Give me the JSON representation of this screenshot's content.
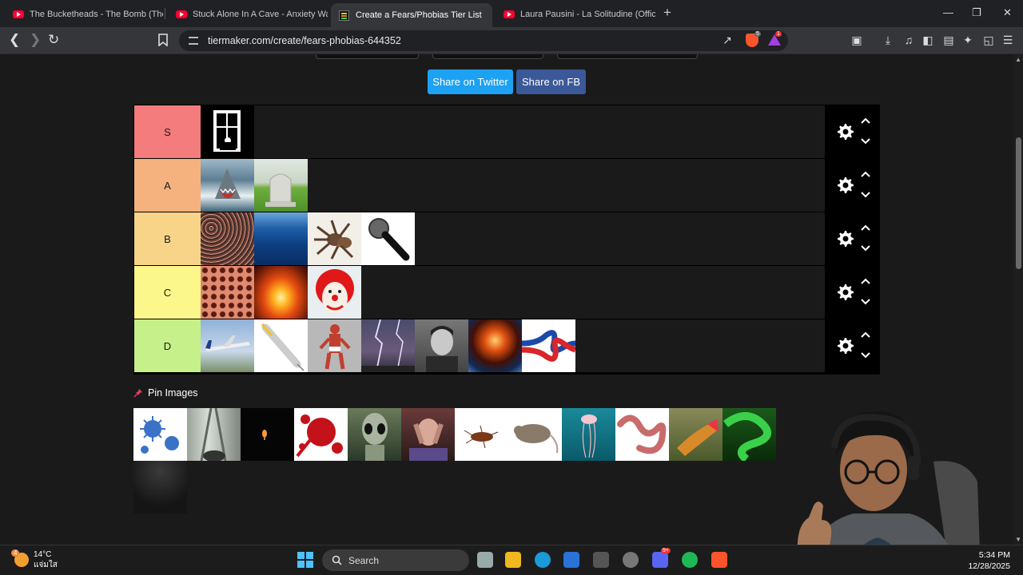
{
  "browser": {
    "tabs": [
      {
        "title": "The Bucketheads - The Bomb (These",
        "favicon": "youtube-icon",
        "active": false
      },
      {
        "title": "Stuck Alone In A Cave - Anxiety Warn",
        "favicon": "youtube-icon",
        "active": false
      },
      {
        "title": "Create a Fears/Phobias Tier List",
        "favicon": "tiermaker-icon",
        "active": true,
        "close": "✕"
      },
      {
        "title": "Laura Pausini - La Solitudine (Official",
        "favicon": "youtube-icon",
        "active": false
      }
    ],
    "new_tab": "+",
    "url": "tiermaker.com/create/fears-phobias-644352",
    "brave_badge": "5",
    "rewards_badge": "1",
    "colors": {
      "tab_bg": "#202124",
      "toolbar_bg": "#35363a",
      "brave": "#fb542b"
    }
  },
  "page": {
    "share_twitter": "Share on Twitter",
    "share_fb": "Share on FB",
    "colors": {
      "twitter": "#1da1f2",
      "facebook": "#3b5998",
      "page_bg": "#1a1a1a"
    },
    "tiers": [
      {
        "label": "S",
        "color": "#f47c7c",
        "items": [
          "window-silhouette"
        ]
      },
      {
        "label": "A",
        "color": "#f6b27e",
        "items": [
          "shark",
          "gravestone"
        ]
      },
      {
        "label": "B",
        "color": "#f7d488",
        "items": [
          "crowd",
          "ocean",
          "tarantula",
          "microphone"
        ]
      },
      {
        "label": "C",
        "color": "#fbf78a",
        "items": [
          "holes-cluster",
          "fire",
          "clown"
        ]
      },
      {
        "label": "D",
        "color": "#c6f08a",
        "items": [
          "airplane",
          "syringe",
          "figure",
          "lightning",
          "portrait",
          "explosion",
          "knot"
        ]
      }
    ],
    "pin_images_label": "Pin Images",
    "pool_items": [
      "virus",
      "height",
      "candle",
      "blood",
      "alien",
      "fearful-person",
      "cockroach-rat",
      "jellyfish",
      "worm",
      "lizard",
      "snake",
      "dark-room"
    ]
  },
  "taskbar": {
    "temperature": "14°C",
    "weather_text": "แจ่มใส",
    "weather_badge": "4",
    "search_placeholder": "Search",
    "time": "5:34 PM",
    "date": "12/28/2025",
    "discord_badge": "9+"
  }
}
